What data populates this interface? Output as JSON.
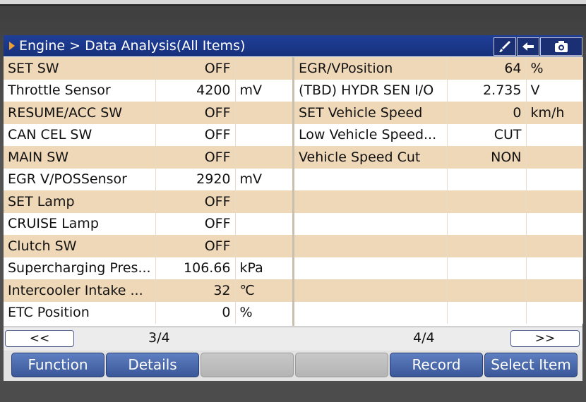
{
  "header": {
    "breadcrumb": "Engine > Data Analysis(All Items)",
    "icons": [
      "brush-icon",
      "back-arrow-icon",
      "camera-icon"
    ]
  },
  "left_table": [
    {
      "name": "SET SW",
      "value": "OFF",
      "unit": ""
    },
    {
      "name": "Throttle Sensor",
      "value": "4200",
      "unit": "mV"
    },
    {
      "name": "RESUME/ACC SW",
      "value": "OFF",
      "unit": ""
    },
    {
      "name": "CAN CEL SW",
      "value": "OFF",
      "unit": ""
    },
    {
      "name": "MAIN SW",
      "value": "OFF",
      "unit": ""
    },
    {
      "name": "EGR V/POSSensor",
      "value": "2920",
      "unit": "mV"
    },
    {
      "name": "SET Lamp",
      "value": "OFF",
      "unit": ""
    },
    {
      "name": "CRUISE Lamp",
      "value": "OFF",
      "unit": ""
    },
    {
      "name": "Clutch SW",
      "value": "OFF",
      "unit": ""
    },
    {
      "name": "Supercharging Pres...",
      "value": "106.66",
      "unit": "kPa"
    },
    {
      "name": "Intercooler Intake ...",
      "value": "32",
      "unit": "℃"
    },
    {
      "name": "ETC Position",
      "value": "0",
      "unit": "%"
    }
  ],
  "right_table": [
    {
      "name": "EGR/VPosition",
      "value": "64",
      "unit": "%"
    },
    {
      "name": "(TBD) HYDR SEN I/O",
      "value": "2.735",
      "unit": "V"
    },
    {
      "name": "SET Vehicle Speed",
      "value": "0",
      "unit": "km/h"
    },
    {
      "name": "Low Vehicle Speed...",
      "value": "CUT",
      "unit": ""
    },
    {
      "name": "Vehicle Speed Cut",
      "value": "NON",
      "unit": ""
    },
    {
      "name": "",
      "value": "",
      "unit": ""
    },
    {
      "name": "",
      "value": "",
      "unit": ""
    },
    {
      "name": "",
      "value": "",
      "unit": ""
    },
    {
      "name": "",
      "value": "",
      "unit": ""
    },
    {
      "name": "",
      "value": "",
      "unit": ""
    },
    {
      "name": "",
      "value": "",
      "unit": ""
    },
    {
      "name": "",
      "value": "",
      "unit": ""
    }
  ],
  "pager": {
    "prev_label": "<<",
    "left_page": "3/4",
    "right_page": "4/4",
    "next_label": ">>"
  },
  "function_bar": {
    "function_label": "Function",
    "details_label": "Details",
    "record_label": "Record",
    "select_item_label": "Select Item"
  },
  "colors": {
    "title_bar": "#1f3f98",
    "row_alt": "#efd8b8",
    "button": "#4a68ae",
    "arrow": "#f0a030"
  }
}
